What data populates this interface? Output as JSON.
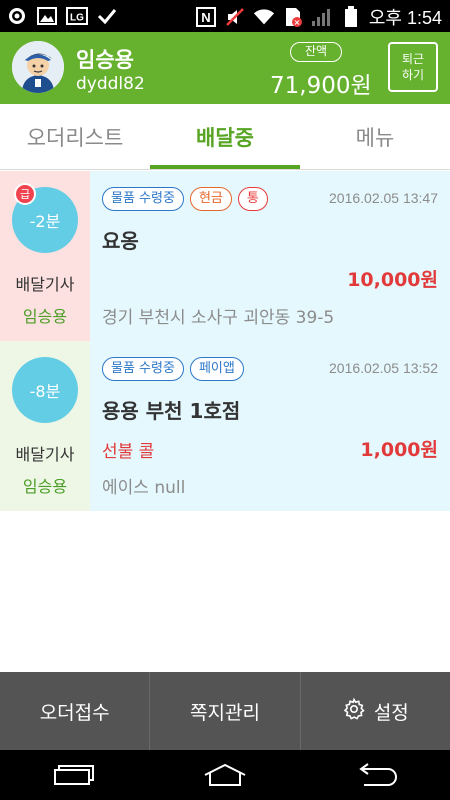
{
  "status_bar": {
    "time": "오후 1:54",
    "icons": [
      "messenger-icon",
      "image-icon",
      "lg-icon",
      "check-icon",
      "nfc-icon",
      "mute-icon",
      "wifi-icon",
      "sim-error-icon",
      "signal-icon",
      "battery-icon"
    ],
    "lg_text": "LG",
    "nfc_text": "N"
  },
  "header": {
    "user_name": "임승용",
    "user_id": "dyddl82",
    "balance_label": "잔액",
    "balance_value": "71,900원",
    "off_work_line1": "퇴근",
    "off_work_line2": "하기",
    "brand_color": "#66b22f"
  },
  "tabs": [
    {
      "label": "오더리스트",
      "active": false
    },
    {
      "label": "배달중",
      "active": true
    },
    {
      "label": "메뉴",
      "active": false
    }
  ],
  "orders": [
    {
      "urgent_badge": "급",
      "time_remaining": "-2분",
      "driver_label": "배달기사",
      "driver_name": "임승용",
      "tags": [
        "물품 수령중",
        "현금",
        "통"
      ],
      "datetime": "2016.02.05 13:47",
      "shop": "요옹",
      "pay_note": "",
      "price": "10,000원",
      "address": "경기 부천시 소사구 괴안동 39-5",
      "left_bg": "#fde0e0"
    },
    {
      "urgent_badge": "",
      "time_remaining": "-8분",
      "driver_label": "배달기사",
      "driver_name": "임승용",
      "tags": [
        "물품 수령중",
        "페이앱"
      ],
      "datetime": "2016.02.05 13:52",
      "shop": "용용 부천 1호점",
      "pay_note": "선불 콜",
      "price": "1,000원",
      "address": "에이스 null",
      "left_bg": "#eef6e6"
    }
  ],
  "action_bar": {
    "order_receive": "오더접수",
    "message_manage": "쪽지관리",
    "settings": "설정"
  },
  "nav_bar": {
    "icons": [
      "recent-apps-icon",
      "home-icon",
      "back-icon"
    ]
  }
}
